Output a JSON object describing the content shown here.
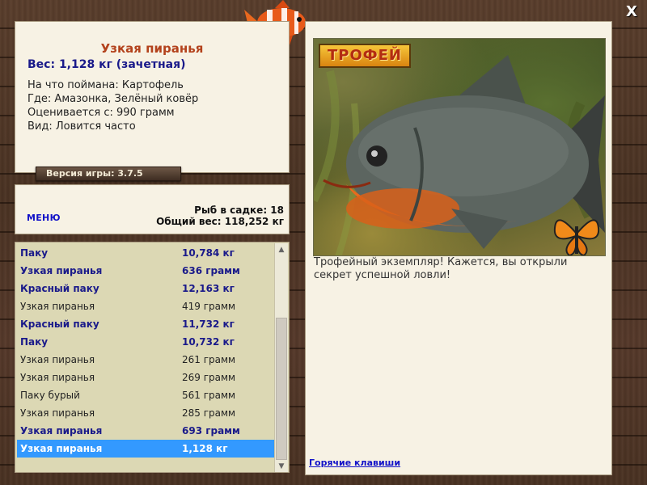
{
  "window": {
    "close_label": "X"
  },
  "info": {
    "title": "Узкая пиранья",
    "weight": "Вес: 1,128 кг (зачетная)",
    "lines": [
      "На что поймана: Картофель",
      "Где: Амазонка, Зелёный ковёр",
      "Оценивается с: 990 грамм",
      "Вид: Ловится часто"
    ]
  },
  "version": "Версия игры: 3.7.5",
  "menu_label": "МЕНЮ",
  "totals": {
    "fish_count": "Рыб в садке: 18",
    "total_weight": "Общий вес: 118,252 кг"
  },
  "catch_list": [
    {
      "name": "Паку",
      "weight": "10,784 кг",
      "style": "bold"
    },
    {
      "name": "Узкая пиранья",
      "weight": "636 грамм",
      "style": "bold"
    },
    {
      "name": "Красный паку",
      "weight": "12,163 кг",
      "style": "bold"
    },
    {
      "name": "Узкая пиранья",
      "weight": "419 грамм",
      "style": "normal"
    },
    {
      "name": "Красный паку",
      "weight": "11,732 кг",
      "style": "bold"
    },
    {
      "name": "Паку",
      "weight": "10,732 кг",
      "style": "bold"
    },
    {
      "name": "Узкая пиранья",
      "weight": "261 грамм",
      "style": "normal"
    },
    {
      "name": "Узкая пиранья",
      "weight": "269 грамм",
      "style": "normal"
    },
    {
      "name": "Паку бурый",
      "weight": "561 грамм",
      "style": "normal"
    },
    {
      "name": "Узкая пиранья",
      "weight": "285 грамм",
      "style": "normal"
    },
    {
      "name": "Узкая пиранья",
      "weight": "693 грамм",
      "style": "bold"
    },
    {
      "name": "Узкая пиранья",
      "weight": "1,128 кг",
      "style": "selected"
    }
  ],
  "trophy_label": "ТРОФЕЙ",
  "description": "Трофейный экземпляр! Кажется, вы открыли секрет успешной ловли!",
  "hotkeys_label": "Горячие клавиши",
  "colors": {
    "title": "#b3421c",
    "accent": "#1a1a8a",
    "link": "#1212c8",
    "selection": "#3399ff"
  }
}
